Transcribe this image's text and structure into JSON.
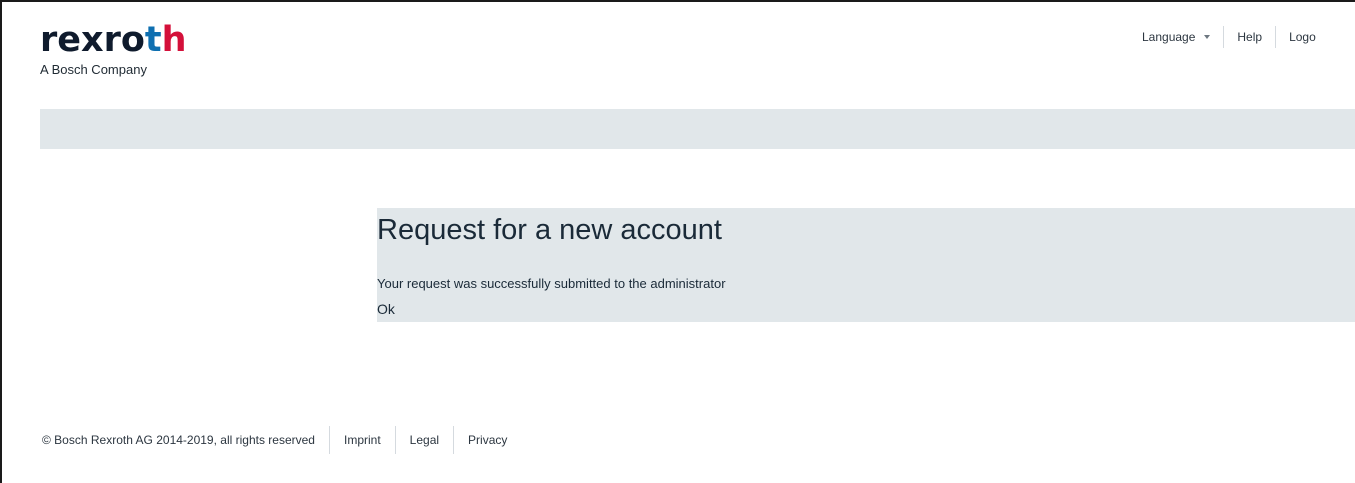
{
  "header": {
    "logo": {
      "word_part1": "rexro",
      "word_part2": "t",
      "word_part3": "h",
      "tagline": "A Bosch Company"
    },
    "nav": {
      "language_label": "Language",
      "help_label": "Help",
      "logout_label": "Logo"
    }
  },
  "main": {
    "title": "Request for a new account",
    "message": "Your request was successfully submitted to the administrator",
    "ok_label": "Ok"
  },
  "footer": {
    "copyright": "© Bosch Rexroth AG 2014-2019, all rights reserved",
    "imprint_label": "Imprint",
    "legal_label": "Legal",
    "privacy_label": "Privacy"
  },
  "colors": {
    "panel_background": "#e1e7ea",
    "text": "#1a2a38",
    "logo_dark": "#0f1b2d",
    "logo_blue": "#0e6fb0",
    "logo_red": "#d4103a"
  },
  "icons": {
    "language_dropdown": "chevron-down-icon"
  }
}
